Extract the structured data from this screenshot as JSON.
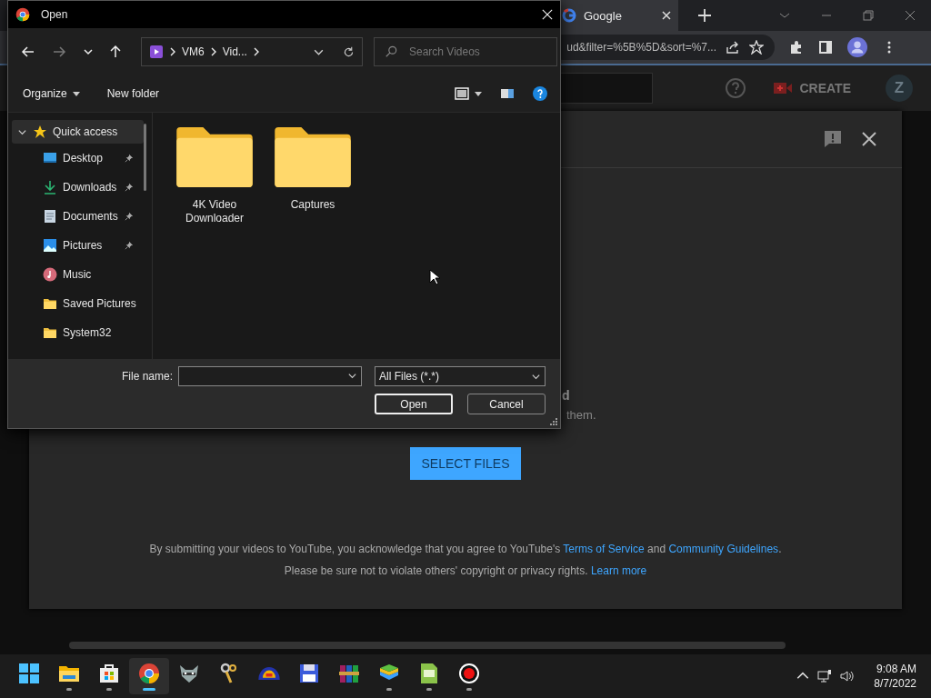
{
  "browser": {
    "tabs": [
      {
        "title": "Google",
        "selected": true
      }
    ],
    "url": "ud&filter=%5B%5D&sort=%7..."
  },
  "youtube": {
    "create": "CREATE",
    "avatar": "Z",
    "upload": {
      "heading": "d",
      "subtitle": "them.",
      "select_button": "SELECT FILES",
      "terms": {
        "before": "By submitting your videos to YouTube, you acknowledge that you agree to YouTube's ",
        "link_1": "Terms of Service",
        "middle": " and ",
        "link_2": "Community Guidelines",
        "after": "."
      },
      "privacy": {
        "before": "Please be sure not to violate others' copyright or privacy rights. ",
        "link": "Learn more"
      }
    }
  },
  "open_dialog": {
    "title": "Open",
    "nav": {
      "back_disabled": false,
      "forward_disabled": true
    },
    "path": [
      "VM6",
      "Vid..."
    ],
    "search_placeholder": "Search Videos",
    "toolbar": [
      "Organize",
      "New folder"
    ],
    "sidebar": [
      {
        "label": "Quick access",
        "kind": "star",
        "expanded": true,
        "selected": true,
        "children": [
          {
            "label": "Desktop",
            "kind": "desktop",
            "pinned": true
          },
          {
            "label": "Downloads",
            "kind": "downloads",
            "pinned": true
          },
          {
            "label": "Documents",
            "kind": "documents",
            "pinned": true
          },
          {
            "label": "Pictures",
            "kind": "pictures",
            "pinned": true
          },
          {
            "label": "Music",
            "kind": "music",
            "pinned": false
          },
          {
            "label": "Saved Pictures",
            "kind": "folder",
            "pinned": false
          },
          {
            "label": "System32",
            "kind": "folder",
            "pinned": false
          }
        ]
      }
    ],
    "folders": [
      {
        "name": "4K Video Downloader"
      },
      {
        "name": "Captures"
      }
    ],
    "file_name_label": "File name:",
    "filter": "All Files (*.*)",
    "buttons": [
      "Open",
      "Cancel"
    ]
  },
  "taskbar": {
    "items": [
      {
        "kind": "start",
        "running": false,
        "selected": false
      },
      {
        "kind": "explorer",
        "running": true,
        "selected": false
      },
      {
        "kind": "store",
        "running": true,
        "selected": false
      },
      {
        "kind": "chrome",
        "running": true,
        "selected": true
      },
      {
        "kind": "raccoon",
        "running": false,
        "selected": false
      },
      {
        "kind": "keys",
        "running": false,
        "selected": false
      },
      {
        "kind": "dome",
        "running": false,
        "selected": false
      },
      {
        "kind": "floppy",
        "running": false,
        "selected": false
      },
      {
        "kind": "archive",
        "running": false,
        "selected": false
      },
      {
        "kind": "layers",
        "running": true,
        "selected": false
      },
      {
        "kind": "apk",
        "running": true,
        "selected": false
      },
      {
        "kind": "record",
        "running": true,
        "selected": false
      }
    ],
    "time": "9:08 AM",
    "date": "8/7/2022"
  }
}
